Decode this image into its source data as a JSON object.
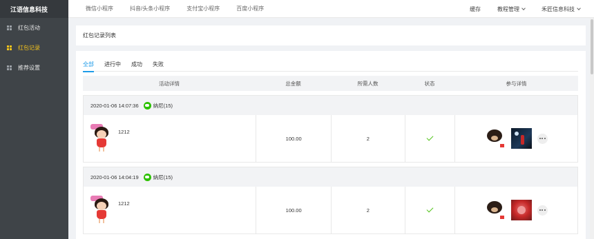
{
  "brand": "江语信息科技",
  "sidebar": {
    "items": [
      {
        "label": "红包活动",
        "icon": "grid-icon",
        "active": false
      },
      {
        "label": "红包记录",
        "icon": "grid-icon",
        "active": true
      },
      {
        "label": "推荐设置",
        "icon": "grid-icon",
        "active": false
      }
    ]
  },
  "topbar": {
    "tabs": [
      "微信小程序",
      "抖音/头条小程序",
      "支付宝小程序",
      "百度小程序"
    ],
    "cache": "缓存",
    "tutorial": "教程管理",
    "account": "禾匠信息科技"
  },
  "page": {
    "title": "红包记录列表"
  },
  "tabs": [
    {
      "label": "全部",
      "active": true
    },
    {
      "label": "进行中",
      "active": false
    },
    {
      "label": "成功",
      "active": false
    },
    {
      "label": "失败",
      "active": false
    }
  ],
  "table": {
    "headers": [
      "活动详情",
      "总金额",
      "所需人数",
      "状态",
      "参与详情"
    ]
  },
  "records": [
    {
      "datetime": "2020-01-06 14:07:36",
      "user": "纳尼(15)",
      "nickname": "1212",
      "amount": "100.00",
      "required": "2",
      "status": "success",
      "participants": [
        "bear-avatar",
        "night-avatar"
      ]
    },
    {
      "datetime": "2020-01-06 14:04:19",
      "user": "纳尼(15)",
      "nickname": "1212",
      "amount": "100.00",
      "required": "2",
      "status": "success",
      "participants": [
        "bear-avatar",
        "rose-avatar"
      ]
    }
  ],
  "colors": {
    "sidebar_bg": "#3f4448",
    "active_nav": "#f5c31b",
    "tab_active": "#1e9be8",
    "success": "#52c41a",
    "wechat": "#2dc100"
  }
}
